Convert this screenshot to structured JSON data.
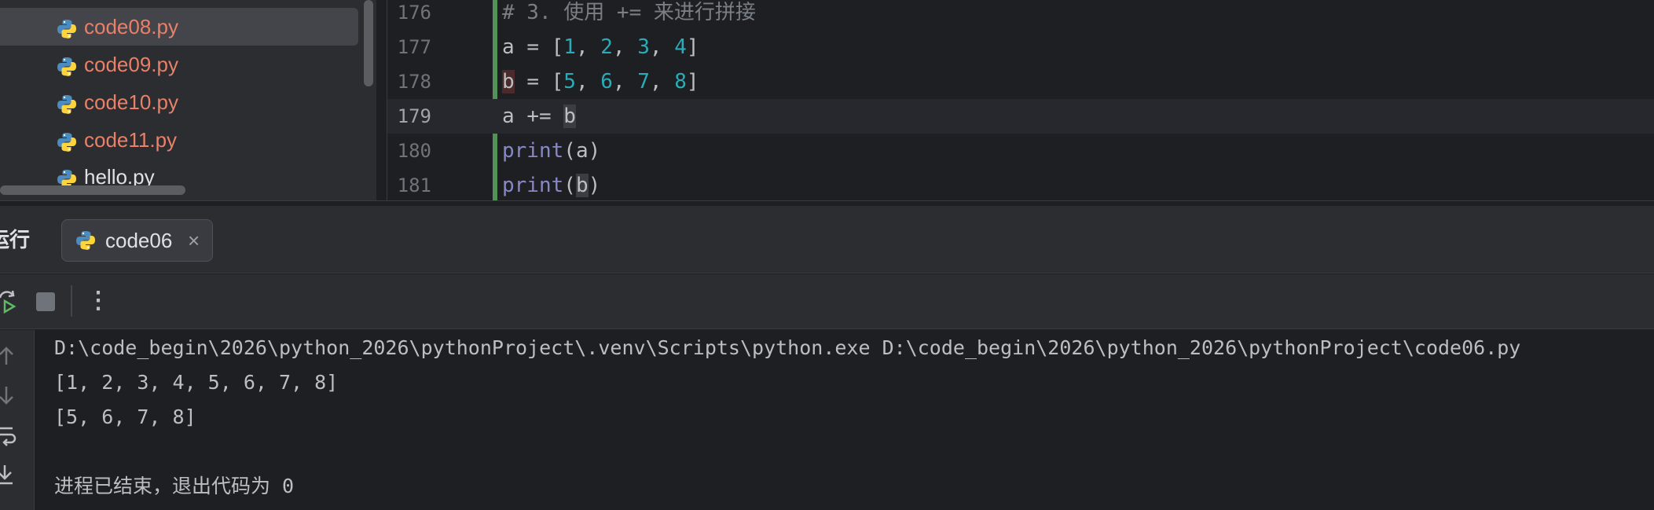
{
  "project_tree": {
    "files": [
      {
        "name": "code08.py",
        "status": "modified",
        "selected": true
      },
      {
        "name": "code09.py",
        "status": "modified",
        "selected": false
      },
      {
        "name": "code10.py",
        "status": "modified",
        "selected": false
      },
      {
        "name": "code11.py",
        "status": "modified",
        "selected": false
      },
      {
        "name": "hello.py",
        "status": "normal",
        "selected": false
      }
    ]
  },
  "editor": {
    "current_line": "179",
    "lines": [
      {
        "no": "176",
        "text": "# 3. 使用 += 来进行拼接"
      },
      {
        "no": "177",
        "text": "a = [1, 2, 3, 4]"
      },
      {
        "no": "178",
        "text": "b = [5, 6, 7, 8]"
      },
      {
        "no": "179",
        "text": "a += b"
      },
      {
        "no": "180",
        "text": "print(a)"
      },
      {
        "no": "181",
        "text": "print(b)"
      }
    ]
  },
  "run_window": {
    "title": "运行",
    "tab_label": "code06",
    "tab_close": "×",
    "more_label": "⋮"
  },
  "console": {
    "lines": [
      "D:\\code_begin\\2026\\python_2026\\pythonProject\\.venv\\Scripts\\python.exe D:\\code_begin\\2026\\python_2026\\pythonProject\\code06.py",
      "[1, 2, 3, 4, 5, 6, 7, 8]",
      "[5, 6, 7, 8]",
      "",
      "进程已结束，退出代码为 0"
    ]
  },
  "colors": {
    "background": "#1e1f22",
    "panel": "#2b2d30",
    "modified_file": "#e8806a",
    "number_token": "#2aacb8",
    "builtin_token": "#8888c6",
    "change_bar": "#549159"
  },
  "icons": {
    "file": "python-file-icon",
    "rerun": "rerun-icon",
    "stop": "stop-icon",
    "more": "more-vertical-icon",
    "scroll_up": "arrow-up-icon",
    "scroll_down": "arrow-down-icon",
    "soft_wrap": "soft-wrap-icon",
    "scroll_to_end": "scroll-to-end-icon"
  }
}
